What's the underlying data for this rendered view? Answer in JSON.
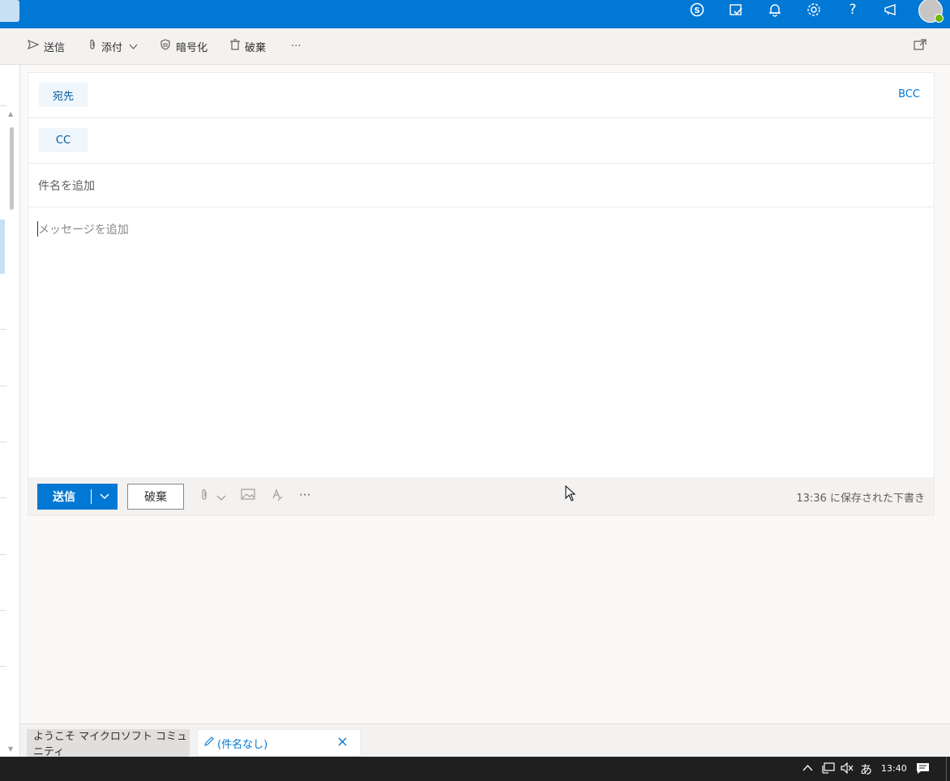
{
  "topbar": {
    "icons": [
      "skype-icon",
      "todo-icon",
      "bell-icon",
      "gear-icon",
      "help-icon",
      "megaphone-icon",
      "avatar"
    ]
  },
  "toolbar": {
    "send_label": "送信",
    "attach_label": "添付",
    "encrypt_label": "暗号化",
    "discard_label": "破棄",
    "more_label": "···"
  },
  "compose": {
    "to_label": "宛先",
    "bcc_label": "BCC",
    "cc_label": "CC",
    "subject_placeholder": "件名を追加",
    "body_placeholder": "メッセージを追加"
  },
  "footer": {
    "send_label": "送信",
    "discard_label": "破棄",
    "more_label": "···",
    "saved_status": "13:36 に保存された下書き"
  },
  "tabs": [
    {
      "label": "ようこそ マイクロソフト コミュニティ"
    },
    {
      "label": "(件名なし)"
    }
  ],
  "taskbar": {
    "ime": "あ",
    "time": "13:40"
  },
  "colors": {
    "accent": "#0078d4",
    "pill": "#eff6fc"
  }
}
